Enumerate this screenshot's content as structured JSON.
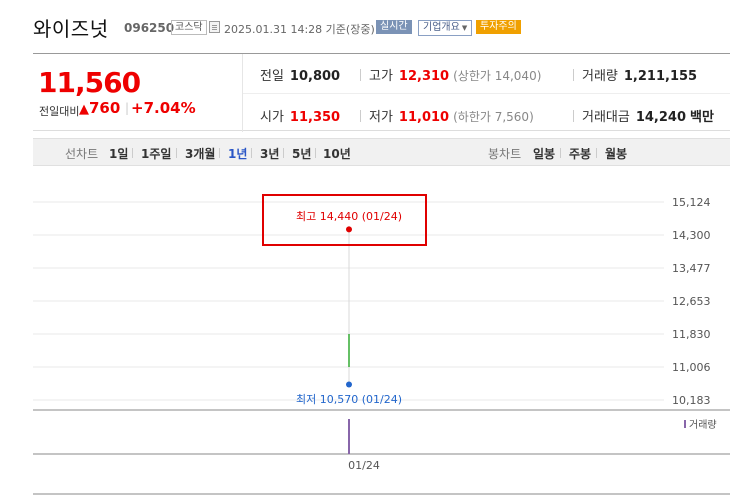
{
  "stock": {
    "name": "와이즈넛",
    "code": "096250",
    "market": "코스닥",
    "timestamp": "2025.01.31 14:28 기준(장중)",
    "realtime_label": "실시간",
    "company_overview_label": "기업개요",
    "warning_label": "투자주의"
  },
  "quote": {
    "current_price": "11,560",
    "change_label": "전일대비",
    "change_amount": "760",
    "change_rate": "+7.04%",
    "prev_close_label": "전일",
    "prev_close": "10,800",
    "high_label": "고가",
    "high": "12,310",
    "upper_limit": "(상한가 14,040)",
    "volume_label": "거래량",
    "volume": "1,211,155",
    "open_label": "시가",
    "open": "11,350",
    "low_label": "저가",
    "low": "11,010",
    "lower_limit": "(하한가 7,560)",
    "trade_value_label": "거래대금",
    "trade_value": "14,240",
    "trade_value_unit": "백만"
  },
  "periods": {
    "line_label": "선차트",
    "line_tabs": [
      "1일",
      "1주일",
      "3개월",
      "1년",
      "3년",
      "5년",
      "10년"
    ],
    "active_tab": "1년",
    "candle_label": "봉차트",
    "candle_tabs": [
      "일봉",
      "주봉",
      "월봉"
    ]
  },
  "colors": {
    "up": "#e00000",
    "highlight_box": "#e00000",
    "low_marker": "#2266cc",
    "green_candle": "#33aa33",
    "volume_bar": "#8866aa"
  },
  "chart_data": {
    "type": "line",
    "y_ticks": [
      "15,124",
      "14,300",
      "13,477",
      "12,653",
      "11,830",
      "11,006",
      "10,183"
    ],
    "ylim": [
      10183,
      15124
    ],
    "x_ticks": [
      "01/24"
    ],
    "high_marker": {
      "label": "최고 14,440 (01/24)",
      "value": 14440,
      "date": "01/24"
    },
    "low_marker": {
      "label": "최저 10,570 (01/24)",
      "value": 10570,
      "date": "01/24"
    },
    "candle": {
      "date": "01/24",
      "low": 11006,
      "high": 11830
    },
    "volume_label": "거래량",
    "grid": true
  }
}
